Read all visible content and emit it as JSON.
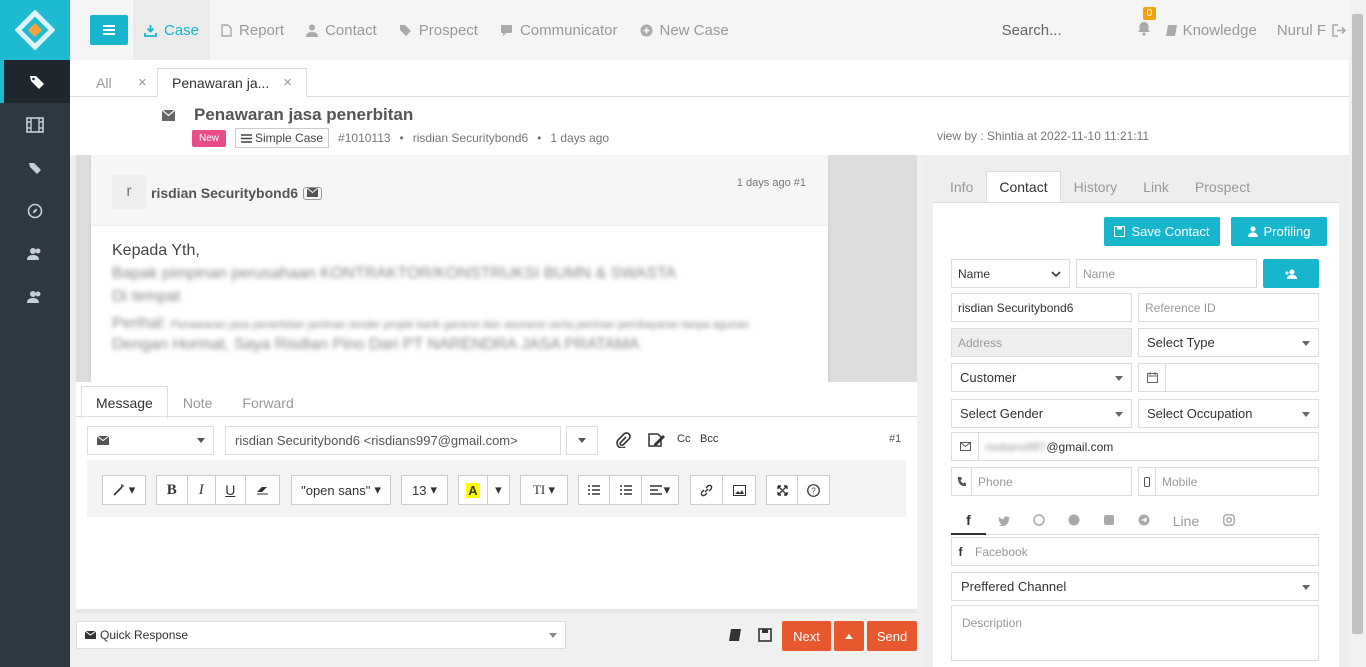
{
  "nav": {
    "items": [
      {
        "label": "Case",
        "active": true
      },
      {
        "label": "Report"
      },
      {
        "label": "Contact"
      },
      {
        "label": "Prospect"
      },
      {
        "label": "Communicator"
      },
      {
        "label": "New Case"
      }
    ],
    "search_placeholder": "Search...",
    "notif_count": "0",
    "knowledge": "Knowledge",
    "user": "Nurul F"
  },
  "tabs": {
    "all": "All",
    "current": "Penawaran ja..."
  },
  "case": {
    "title": "Penawaran jasa penerbitan",
    "badge": "New",
    "type": "Simple Case",
    "id": "#1010113",
    "sep": "•",
    "author": "risdian Securitybond6",
    "age": "1 days ago",
    "viewby": "view by : Shintia at 2022-11-10 11:21:11"
  },
  "message": {
    "avatar": "r",
    "sender": "risdian Securitybond6",
    "time": "1 days ago #1",
    "line1": "Kepada Yth,",
    "line2": "Bapak pimpinan perusahaan KONTRAKTOR/KONSTRUKSI BUMN & SWASTA",
    "line3": "Di tempat",
    "line4_label": "Perihal:",
    "line4": "Penawaran jasa penerbitan jaminan tender projek bank garansi dan asuransi serta jaminan pembayaran tanpa agunan",
    "line5": "Dengan Hormat, Saya Risdian Pino Dari PT NARENDRA JASA PRATAMA"
  },
  "composer": {
    "tabs": [
      "Message",
      "Note",
      "Forward"
    ],
    "to": "risdian Securitybond6 <risdians997@gmail.com>",
    "cc": "Cc",
    "bcc": "Bcc",
    "num": "#1",
    "font": "\"open sans\"",
    "size": "13",
    "quick_response": "Quick Response",
    "next": "Next",
    "send": "Send"
  },
  "right": {
    "tabs": [
      "Info",
      "Contact",
      "History",
      "Link",
      "Prospect"
    ],
    "save_contact": "Save Contact",
    "profiling": "Profiling",
    "name_select": "Name",
    "name_placeholder": "Name",
    "contact_name": "risdian Securitybond6",
    "ref_placeholder": "Reference ID",
    "address_placeholder": "Address",
    "select_type": "Select Type",
    "customer": "Customer",
    "gender": "Select Gender",
    "occupation": "Select Occupation",
    "email_blur": "risdians997",
    "email_domain": "@gmail.com",
    "phone": "Phone",
    "mobile": "Mobile",
    "line": "Line",
    "facebook": "Facebook",
    "channel": "Preffered Channel",
    "description": "Description"
  },
  "colors": {
    "accent": "#17b6cc",
    "sidebar": "#2e3841",
    "danger": "#e8582e",
    "badge_new": "#ea4c89"
  }
}
